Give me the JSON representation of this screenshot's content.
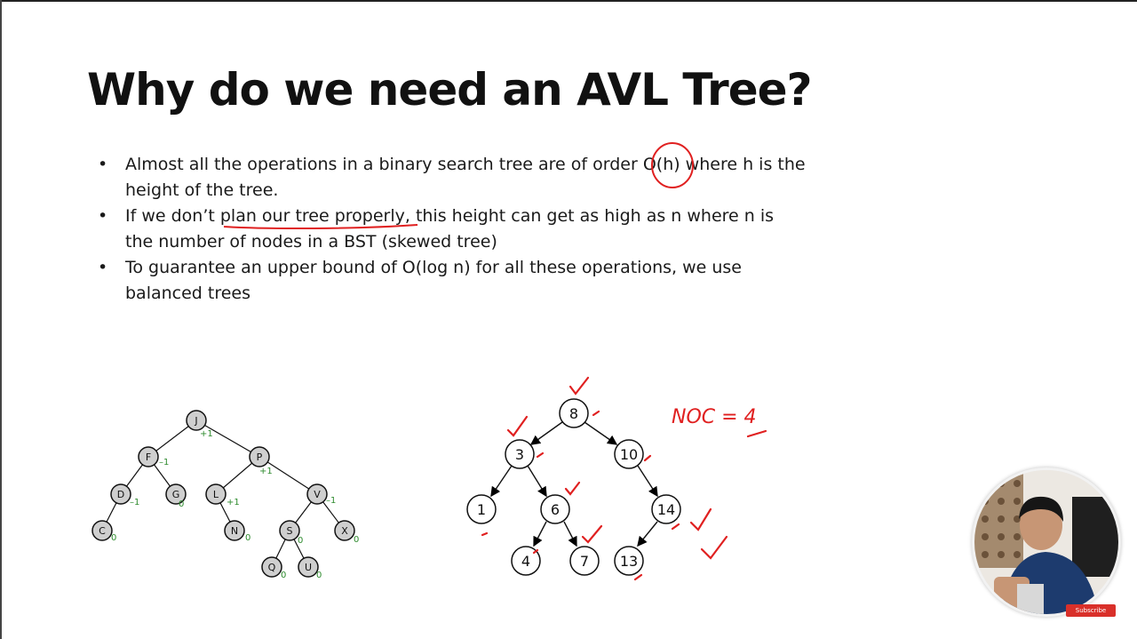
{
  "slide": {
    "title": "Why do we need an AVL Tree?",
    "bullets": [
      {
        "marker": "•",
        "text": "Almost all the operations in a binary search tree are of order O(h) where h is the height of the tree."
      },
      {
        "marker": "•",
        "text": "If we don’t plan our tree properly, this height can get as high as n where n is the number of nodes in a BST (skewed tree)"
      },
      {
        "marker": "•",
        "text": " To guarantee an upper bound of O(log n) for all these operations, we use balanced trees"
      }
    ]
  },
  "avl_tree": {
    "nodes": [
      {
        "label": "J",
        "balance": "+1"
      },
      {
        "label": "F",
        "balance": "–1"
      },
      {
        "label": "P",
        "balance": "+1"
      },
      {
        "label": "D",
        "balance": "–1"
      },
      {
        "label": "G",
        "balance": "0"
      },
      {
        "label": "L",
        "balance": "+1"
      },
      {
        "label": "V",
        "balance": "–1"
      },
      {
        "label": "C",
        "balance": "0"
      },
      {
        "label": "N",
        "balance": "0"
      },
      {
        "label": "S",
        "balance": "0"
      },
      {
        "label": "X",
        "balance": "0"
      },
      {
        "label": "Q",
        "balance": "0"
      },
      {
        "label": "U",
        "balance": "0"
      }
    ],
    "node_fill": "#cfcfcf",
    "balance_color": "#2e8b2e"
  },
  "bst": {
    "nodes": [
      "8",
      "3",
      "10",
      "1",
      "6",
      "14",
      "4",
      "7",
      "13"
    ]
  },
  "annotation": {
    "text": "NOC = 4",
    "ink_color": "#e02020"
  },
  "webcam": {
    "subscribe_label": "Subscribe"
  }
}
